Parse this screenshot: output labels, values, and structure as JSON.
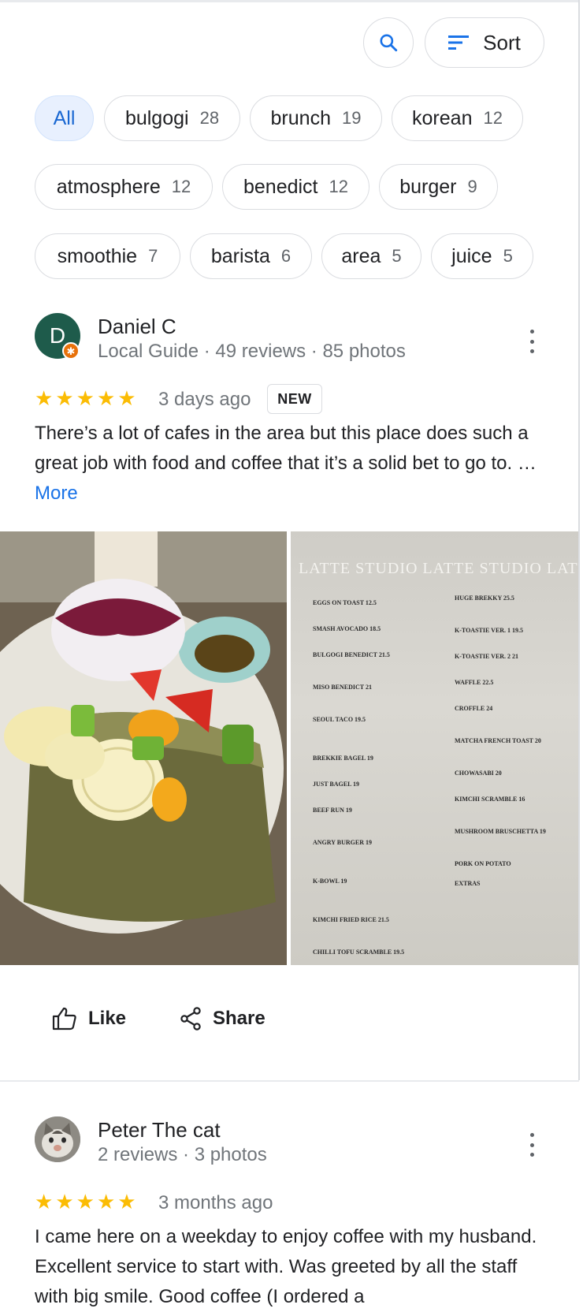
{
  "toolbar": {
    "sort_label": "Sort",
    "icons": {
      "search": "search-icon",
      "sort": "sort-lines-icon"
    }
  },
  "chips": [
    {
      "label": "All",
      "count": ""
    },
    {
      "label": "bulgogi",
      "count": "28"
    },
    {
      "label": "brunch",
      "count": "19"
    },
    {
      "label": "korean",
      "count": "12"
    },
    {
      "label": "atmosphere",
      "count": "12"
    },
    {
      "label": "benedict",
      "count": "12"
    },
    {
      "label": "burger",
      "count": "9"
    },
    {
      "label": "smoothie",
      "count": "7"
    },
    {
      "label": "barista",
      "count": "6"
    },
    {
      "label": "area",
      "count": "5"
    },
    {
      "label": "juice",
      "count": "5"
    }
  ],
  "reviews": [
    {
      "avatar_letter": "D",
      "name": "Daniel C",
      "meta": "Local Guide · 49 reviews · 85 photos",
      "rating": 5,
      "when": "3 days ago",
      "badge": "NEW",
      "text": "There’s a lot of cafes in the area but this place does such a great job with food and coffee that it’s a solid bet to go to. …",
      "more_label": "More",
      "like_label": "Like",
      "share_label": "Share",
      "menu_title": "LATTE STUDIO LATTE STUDIO LATTE STUDIO",
      "menu_left": [
        "EGGS ON TOAST 12.5",
        "SMASH AVOCADO 18.5",
        "BULGOGI BENEDICT 21.5",
        "MISO BENEDICT 21",
        "SEOUL TACO 19.5",
        "BREKKIE BAGEL 19",
        "JUST BAGEL 19",
        "BEEF RUN 19",
        "ANGRY BURGER 19",
        "K-BOWL 19",
        "KIMCHI FRIED RICE 21.5",
        "CHILLI TOFU SCRAMBLE 19.5"
      ],
      "menu_right": [
        "HUGE BREKKY 25.5",
        "K-TOASTIE VER. 1 19.5",
        "K-TOASTIE VER. 2 21",
        "WAFFLE 22.5",
        "CROFFLE 24",
        "MATCHA FRENCH TOAST 20",
        "CHOWASABI 20",
        "KIMCHI SCRAMBLE 16",
        "MUSHROOM BRUSCHETTA 19",
        "PORK ON POTATO",
        "EXTRAS"
      ]
    },
    {
      "name": "Peter The cat",
      "meta": "2 reviews · 3 photos",
      "rating": 5,
      "when": "3 months ago",
      "text": "I came here on a weekday to enjoy coffee with my husband. Excellent service to start with. Was greeted by all the staff with big smile. Good coffee (I ordered a"
    }
  ],
  "colors": {
    "accent": "#1a73e8",
    "star": "#fbbc04",
    "chip_active_bg": "#e8f0fe",
    "avatar_d": "#1e5b4b",
    "guide_badge": "#e8710a"
  }
}
